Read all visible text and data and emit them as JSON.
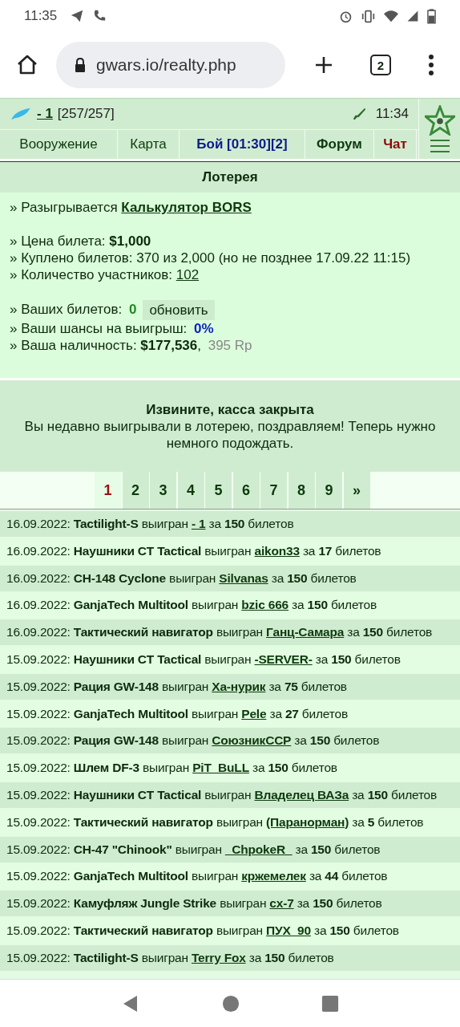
{
  "status_bar": {
    "time": "11:35"
  },
  "browser": {
    "url": "gwars.io/realty.php",
    "tab_count": "2"
  },
  "header": {
    "player": "- 1",
    "hp": "[257/257]",
    "time": "11:34"
  },
  "nav": [
    {
      "label": "Вооружение",
      "kind": "plain"
    },
    {
      "label": "Карта",
      "kind": "plain"
    },
    {
      "label": "Бой [01:30][2]",
      "kind": "battle"
    },
    {
      "label": "Форум",
      "kind": "forum"
    },
    {
      "label": "Чат",
      "kind": "chat"
    }
  ],
  "panel": {
    "title": "Лотерея",
    "prize": {
      "label": "» Разыгрывается",
      "link": "Калькулятор BORS"
    },
    "price": "» Цена билета: **$1,000**",
    "sold": "» Куплено билетов: 370 из 2,000 (но не позднее 17.09.22 11:15)",
    "participants": {
      "label": "» Количество участников:",
      "link": "102"
    },
    "tickets": {
      "label": "» Ваших билетов:",
      "value": "0",
      "button": "обновить"
    },
    "chance": {
      "label": "» Ваши шансы на выигрыш:",
      "value": "0%"
    },
    "cash": {
      "label": "» Ваша наличность: **$177,536**,",
      "extra": "395 Rp"
    }
  },
  "notice": {
    "title": "Извините, касса закрыта",
    "message": "Вы недавно выигрывали в лотерею, поздравляем! Теперь нужно немного подождать."
  },
  "pages": [
    {
      "label": "1",
      "selected": true
    },
    {
      "label": "2",
      "selected": false
    },
    {
      "label": "3",
      "selected": false
    },
    {
      "label": "4",
      "selected": false
    },
    {
      "label": "5",
      "selected": false
    },
    {
      "label": "6",
      "selected": false
    },
    {
      "label": "7",
      "selected": false
    },
    {
      "label": "8",
      "selected": false
    },
    {
      "label": "9",
      "selected": false
    },
    {
      "label": "»",
      "selected": false
    }
  ],
  "history": [
    {
      "before": "16.09.2022: **Tactilight-S** выигран",
      "winner": "- 1",
      "after": "за **150** билетов"
    },
    {
      "before": "16.09.2022: **Наушники CT Tactical** выигран",
      "winner": "aikon33",
      "after": "за **17** билетов"
    },
    {
      "before": "16.09.2022: **CH-148 Cyclone** выигран",
      "winner": "Silvanas",
      "after": "за **150** билетов"
    },
    {
      "before": "16.09.2022: **GanjaTech Multitool** выигран",
      "winner": "bzic 666",
      "after": "за **150** билетов"
    },
    {
      "before": "16.09.2022: **Тактический навигатор** выигран",
      "winner": "Ганц-Самара",
      "after": "за **150** билетов"
    },
    {
      "before": "15.09.2022: **Наушники CT Tactical** выигран",
      "winner": "-SERVER-",
      "after": "за **150** билетов"
    },
    {
      "before": "15.09.2022: **Рация GW-148** выигран",
      "winner": "Ха-нурик",
      "after": "за **75** билетов"
    },
    {
      "before": "15.09.2022: **GanjaTech Multitool** выигран",
      "winner": "Pele",
      "after": "за **27** билетов"
    },
    {
      "before": "15.09.2022: **Рация GW-148** выигран",
      "winner": "СоюзникССР",
      "after": "за **150** билетов"
    },
    {
      "before": "15.09.2022: **Шлем DF-3** выигран",
      "winner": "PiT_BuLL",
      "after": "за **150** билетов"
    },
    {
      "before": "15.09.2022: **Наушники CT Tactical** выигран",
      "winner": "Владелец ВАЗа",
      "after": "за **150** билетов"
    },
    {
      "before": "15.09.2022: **Тактический навигатор** выигран",
      "winner": "(Паранорман)",
      "after": "за **5** билетов"
    },
    {
      "before": "15.09.2022: **CH-47 \"Chinook\"** выигран",
      "winner": "_ChpokeR_",
      "after": "за **150** билетов"
    },
    {
      "before": "15.09.2022: **GanjaTech Multitool** выигран",
      "winner": "кржемелек",
      "after": "за **44** билетов"
    },
    {
      "before": "15.09.2022: **Камуфляж Jungle Strike** выигран",
      "winner": "cx-7",
      "after": "за **150** билетов"
    },
    {
      "before": "15.09.2022: **Тактический навигатор** выигран",
      "winner": "ПУХ_90",
      "after": "за **150** билетов"
    },
    {
      "before": "15.09.2022: **Tactilight-S** выигран",
      "winner": "Terry Fox",
      "after": "за **150** билетов"
    }
  ]
}
